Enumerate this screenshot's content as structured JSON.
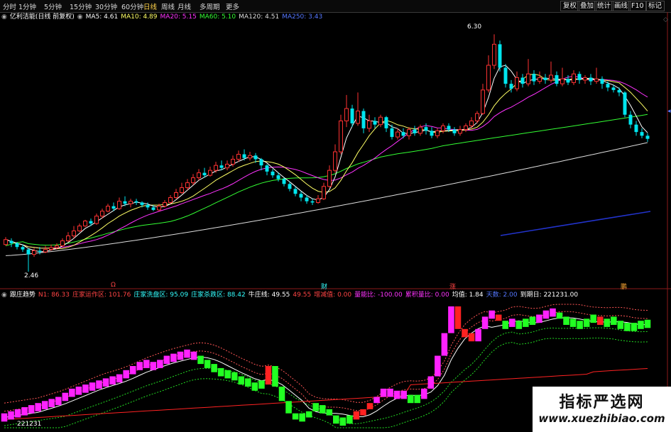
{
  "toolbar": {
    "left_tabs": [
      "分时",
      "1分钟",
      "5分钟",
      "15分钟",
      "30分钟",
      "60分钟",
      "日线",
      "周线",
      "月线",
      "多周期",
      "更多"
    ],
    "active_tab": "日线",
    "right_tabs": [
      "复权",
      "叠加",
      "统计",
      "画线",
      "F10",
      "标记"
    ]
  },
  "main_header": {
    "stock": "亿利洁能(日线 前复权)",
    "ma": [
      {
        "label": "MA5: 4.61",
        "color": "#ffffff"
      },
      {
        "label": "MA10: 4.89",
        "color": "#ffff66"
      },
      {
        "label": "MA20: 5.15",
        "color": "#ff33ff"
      },
      {
        "label": "MA60: 5.10",
        "color": "#33ff33"
      },
      {
        "label": "MA120: 4.51",
        "color": "#dddddd"
      },
      {
        "label": "MA250: 3.43",
        "color": "#5577ff"
      }
    ]
  },
  "sub_header": {
    "name": "跟庄趋势",
    "items": [
      {
        "label": "N1: 86.33",
        "color": "#ff4444"
      },
      {
        "label": "庄家运作区: 101.76",
        "color": "#ff4444"
      },
      {
        "label": "庄家洗盘区: 95.09",
        "color": "#33ffff"
      },
      {
        "label": "庄家杀跌区: 88.42",
        "color": "#33ffff"
      },
      {
        "label": "牛庄线: 49.55",
        "color": "#ffffff"
      },
      {
        "label": "49.55",
        "color": "#ff4444"
      },
      {
        "label": "增减值: 0.00",
        "color": "#ff4444"
      },
      {
        "label": "量能比: -100.00",
        "color": "#ff33ff"
      },
      {
        "label": "累积量比: 0.00",
        "color": "#ff33ff"
      },
      {
        "label": "均值: 1.84",
        "color": "#ffffff"
      },
      {
        "label": "天数: 2.00",
        "color": "#5577ff"
      },
      {
        "label": "到期日: 221231.00",
        "color": "#ffffff"
      }
    ]
  },
  "annotations": {
    "high_label": "6.30",
    "low_label": "2.46",
    "date_label": "221231",
    "event_markers": [
      "Ω",
      "财",
      "涨",
      "鹏"
    ]
  },
  "colors": {
    "up": "#ff3232",
    "down": "#00e5ee",
    "ma5": "#ffffff",
    "ma10": "#ffff66",
    "ma20": "#ff33ff",
    "ma60": "#33ff33",
    "ma120": "#dddddd",
    "ma250": "#2233cc",
    "zone_red": "#ff2222",
    "zone_magenta": "#ff22ff",
    "zone_green": "#22ff22"
  },
  "watermark": {
    "title": "指标严选网",
    "url": "www.xuezhibiao.com"
  },
  "chart_data": [
    {
      "type": "candlestick",
      "title": "亿利洁能(日线 前复权)",
      "y_range": [
        2.3,
        6.5
      ],
      "note": "values estimated from the chart, sequence of daily open/close/high/low",
      "candles": [
        [
          2.9,
          2.98,
          3.02,
          2.88
        ],
        [
          2.96,
          2.92,
          3.0,
          2.86
        ],
        [
          2.92,
          2.86,
          2.94,
          2.82
        ],
        [
          2.86,
          2.82,
          2.9,
          2.78
        ],
        [
          2.82,
          2.74,
          2.84,
          2.46
        ],
        [
          2.74,
          2.8,
          2.84,
          2.7
        ],
        [
          2.8,
          2.78,
          2.86,
          2.74
        ],
        [
          2.78,
          2.82,
          2.88,
          2.76
        ],
        [
          2.82,
          2.85,
          2.9,
          2.8
        ],
        [
          2.85,
          2.88,
          2.92,
          2.82
        ],
        [
          2.88,
          2.96,
          3.0,
          2.86
        ],
        [
          2.96,
          3.04,
          3.1,
          2.94
        ],
        [
          3.04,
          3.12,
          3.2,
          3.0
        ],
        [
          3.12,
          3.2,
          3.24,
          3.1
        ],
        [
          3.2,
          3.28,
          3.3,
          3.18
        ],
        [
          3.28,
          3.24,
          3.32,
          3.2
        ],
        [
          3.24,
          3.36,
          3.4,
          3.22
        ],
        [
          3.36,
          3.44,
          3.48,
          3.32
        ],
        [
          3.44,
          3.52,
          3.56,
          3.42
        ],
        [
          3.52,
          3.48,
          3.58,
          3.44
        ],
        [
          3.48,
          3.6,
          3.66,
          3.46
        ],
        [
          3.6,
          3.56,
          3.68,
          3.52
        ],
        [
          3.56,
          3.6,
          3.64,
          3.5
        ],
        [
          3.6,
          3.58,
          3.64,
          3.54
        ],
        [
          3.58,
          3.54,
          3.6,
          3.5
        ],
        [
          3.54,
          3.5,
          3.58,
          3.46
        ],
        [
          3.5,
          3.46,
          3.54,
          3.44
        ],
        [
          3.46,
          3.52,
          3.56,
          3.44
        ],
        [
          3.52,
          3.58,
          3.62,
          3.5
        ],
        [
          3.58,
          3.66,
          3.7,
          3.56
        ],
        [
          3.66,
          3.74,
          3.8,
          3.64
        ],
        [
          3.74,
          3.82,
          3.9,
          3.72
        ],
        [
          3.82,
          3.9,
          3.96,
          3.78
        ],
        [
          3.9,
          3.98,
          4.04,
          3.86
        ],
        [
          3.98,
          4.06,
          4.12,
          3.94
        ],
        [
          4.06,
          4.02,
          4.14,
          3.98
        ],
        [
          4.02,
          4.1,
          4.16,
          4.0
        ],
        [
          4.1,
          4.18,
          4.24,
          4.06
        ],
        [
          4.18,
          4.14,
          4.26,
          4.1
        ],
        [
          4.14,
          4.2,
          4.26,
          4.1
        ],
        [
          4.2,
          4.28,
          4.34,
          4.16
        ],
        [
          4.28,
          4.36,
          4.42,
          4.24
        ],
        [
          4.36,
          4.3,
          4.44,
          4.26
        ],
        [
          4.3,
          4.34,
          4.4,
          4.26
        ],
        [
          4.34,
          4.28,
          4.38,
          4.22
        ],
        [
          4.28,
          4.18,
          4.3,
          4.1
        ],
        [
          4.18,
          4.08,
          4.2,
          4.02
        ],
        [
          4.08,
          4.02,
          4.12,
          3.98
        ],
        [
          4.02,
          3.96,
          4.06,
          3.92
        ],
        [
          3.96,
          3.88,
          3.98,
          3.84
        ],
        [
          3.88,
          3.8,
          3.92,
          3.76
        ],
        [
          3.8,
          3.72,
          3.84,
          3.68
        ],
        [
          3.72,
          3.66,
          3.76,
          3.6
        ],
        [
          3.66,
          3.6,
          3.7,
          3.56
        ],
        [
          3.6,
          3.58,
          3.64,
          3.54
        ],
        [
          3.58,
          3.64,
          3.7,
          3.56
        ],
        [
          3.64,
          3.84,
          3.9,
          3.62
        ],
        [
          3.84,
          4.1,
          4.18,
          3.82
        ],
        [
          4.1,
          4.4,
          4.52,
          4.06
        ],
        [
          4.4,
          4.9,
          5.0,
          4.36
        ],
        [
          4.9,
          5.1,
          5.32,
          4.8
        ],
        [
          5.1,
          4.86,
          5.16,
          4.8
        ],
        [
          4.86,
          5.06,
          5.36,
          4.82
        ],
        [
          5.06,
          4.78,
          5.1,
          4.7
        ],
        [
          4.78,
          4.9,
          5.0,
          4.72
        ],
        [
          4.9,
          4.84,
          4.96,
          4.78
        ],
        [
          4.84,
          4.96,
          5.0,
          4.8
        ],
        [
          4.96,
          4.78,
          4.98,
          4.72
        ],
        [
          4.78,
          4.64,
          4.84,
          4.6
        ],
        [
          4.64,
          4.72,
          4.78,
          4.6
        ],
        [
          4.72,
          4.66,
          4.78,
          4.62
        ],
        [
          4.66,
          4.76,
          4.8,
          4.6
        ],
        [
          4.76,
          4.7,
          4.82,
          4.66
        ],
        [
          4.7,
          4.8,
          4.84,
          4.66
        ],
        [
          4.8,
          4.74,
          4.86,
          4.68
        ],
        [
          4.74,
          4.66,
          4.8,
          4.62
        ],
        [
          4.66,
          4.74,
          4.78,
          4.62
        ],
        [
          4.74,
          4.82,
          4.86,
          4.7
        ],
        [
          4.82,
          4.76,
          4.86,
          4.72
        ],
        [
          4.76,
          4.7,
          4.8,
          4.66
        ],
        [
          4.7,
          4.76,
          4.82,
          4.66
        ],
        [
          4.76,
          4.82,
          4.86,
          4.72
        ],
        [
          4.82,
          4.9,
          4.96,
          4.78
        ],
        [
          4.9,
          5.02,
          5.06,
          4.86
        ],
        [
          5.02,
          5.4,
          5.5,
          5.0
        ],
        [
          5.4,
          5.8,
          5.96,
          5.36
        ],
        [
          5.8,
          6.14,
          6.3,
          5.74
        ],
        [
          6.14,
          5.76,
          6.2,
          5.7
        ],
        [
          5.76,
          5.5,
          5.82,
          5.44
        ],
        [
          5.5,
          5.42,
          5.56,
          5.36
        ],
        [
          5.42,
          5.6,
          5.7,
          5.38
        ],
        [
          5.6,
          5.5,
          5.66,
          5.44
        ],
        [
          5.5,
          5.66,
          5.9,
          5.46
        ],
        [
          5.66,
          5.54,
          5.72,
          5.48
        ],
        [
          5.54,
          5.6,
          5.7,
          5.5
        ],
        [
          5.6,
          5.56,
          5.66,
          5.5
        ],
        [
          5.56,
          5.64,
          5.86,
          5.52
        ],
        [
          5.64,
          5.5,
          5.7,
          5.46
        ],
        [
          5.5,
          5.58,
          5.76,
          5.46
        ],
        [
          5.58,
          5.52,
          5.64,
          5.48
        ],
        [
          5.52,
          5.66,
          5.72,
          5.48
        ],
        [
          5.66,
          5.56,
          5.7,
          5.5
        ],
        [
          5.56,
          5.6,
          5.64,
          5.5
        ],
        [
          5.6,
          5.54,
          5.66,
          5.48
        ],
        [
          5.54,
          5.58,
          5.76,
          5.5
        ],
        [
          5.58,
          5.5,
          5.62,
          5.42
        ],
        [
          5.5,
          5.44,
          5.54,
          5.38
        ],
        [
          5.44,
          5.4,
          5.48,
          5.36
        ],
        [
          5.4,
          5.36,
          5.44,
          5.3
        ],
        [
          5.36,
          5.0,
          5.38,
          4.96
        ],
        [
          5.0,
          4.84,
          5.06,
          4.78
        ],
        [
          4.84,
          4.72,
          4.9,
          4.66
        ],
        [
          4.72,
          4.66,
          4.78,
          4.62
        ],
        [
          4.66,
          4.61,
          4.7,
          4.56
        ]
      ]
    },
    {
      "type": "heatmap-bar",
      "title": "跟庄趋势",
      "y_range": [
        0,
        120
      ],
      "bars": [
        {
          "c": "m",
          "v": 10
        },
        {
          "c": "m",
          "v": 12
        },
        {
          "c": "m",
          "v": 14
        },
        {
          "c": "m",
          "v": 16
        },
        {
          "c": "m",
          "v": 18
        },
        {
          "c": "m",
          "v": 20
        },
        {
          "c": "m",
          "v": 22
        },
        {
          "c": "m",
          "v": 24
        },
        {
          "c": "m",
          "v": 26
        },
        {
          "c": "m",
          "v": 30
        },
        {
          "c": "m",
          "v": 34
        },
        {
          "c": "m",
          "v": 36
        },
        {
          "c": "m",
          "v": 38
        },
        {
          "c": "m",
          "v": 40
        },
        {
          "c": "m",
          "v": 42
        },
        {
          "c": "m",
          "v": 44
        },
        {
          "c": "m",
          "v": 46
        },
        {
          "c": "m",
          "v": 48
        },
        {
          "c": "m",
          "v": 52
        },
        {
          "c": "m",
          "v": 56
        },
        {
          "c": "m",
          "v": 60
        },
        {
          "c": "m",
          "v": 62
        },
        {
          "c": "m",
          "v": 60
        },
        {
          "c": "m",
          "v": 62
        },
        {
          "c": "m",
          "v": 66
        },
        {
          "c": "m",
          "v": 68
        },
        {
          "c": "m",
          "v": 70
        },
        {
          "c": "m",
          "v": 72
        },
        {
          "c": "m",
          "v": 70
        },
        {
          "c": "g",
          "v": 66
        },
        {
          "c": "g",
          "v": 62
        },
        {
          "c": "g",
          "v": 58
        },
        {
          "c": "g",
          "v": 54
        },
        {
          "c": "g",
          "v": 52
        },
        {
          "c": "g",
          "v": 50
        },
        {
          "c": "g",
          "v": 46
        },
        {
          "c": "g",
          "v": 44
        },
        {
          "c": "g",
          "v": 40
        },
        {
          "c": "g",
          "v": 42
        },
        {
          "c": "r",
          "v": 60
        },
        {
          "c": "g",
          "v": 40
        },
        {
          "c": "g",
          "v": 26
        },
        {
          "c": "g",
          "v": 14
        },
        {
          "c": "g",
          "v": 8
        },
        {
          "c": "g",
          "v": 10
        },
        {
          "c": "g",
          "v": 16
        },
        {
          "c": "g",
          "v": 20
        },
        {
          "c": "g",
          "v": 18
        },
        {
          "c": "g",
          "v": 12
        },
        {
          "c": "g",
          "v": 8
        },
        {
          "c": "g",
          "v": 6
        },
        {
          "c": "g",
          "v": 8
        },
        {
          "c": "r",
          "v": 12
        },
        {
          "c": "r",
          "v": 18
        },
        {
          "c": "r",
          "v": 24
        },
        {
          "c": "m",
          "v": 30
        },
        {
          "c": "m",
          "v": 34
        },
        {
          "c": "m",
          "v": 34
        },
        {
          "c": "m",
          "v": 32
        },
        {
          "c": "m",
          "v": 32
        },
        {
          "c": "g",
          "v": 28
        },
        {
          "c": "g",
          "v": 28
        },
        {
          "c": "m",
          "v": 38
        },
        {
          "c": "m",
          "v": 50
        },
        {
          "c": "m",
          "v": 70
        },
        {
          "c": "m",
          "v": 92
        },
        {
          "c": "m",
          "v": 118
        },
        {
          "c": "r",
          "v": 96
        },
        {
          "c": "r",
          "v": 92
        },
        {
          "c": "r",
          "v": 84
        },
        {
          "c": "m",
          "v": 96
        },
        {
          "c": "m",
          "v": 108
        },
        {
          "c": "m",
          "v": 110
        },
        {
          "c": "r",
          "v": 104
        },
        {
          "c": "g",
          "v": 100
        },
        {
          "c": "m",
          "v": 102
        },
        {
          "c": "g",
          "v": 100
        },
        {
          "c": "g",
          "v": 102
        },
        {
          "c": "g",
          "v": 104
        },
        {
          "c": "m",
          "v": 106
        },
        {
          "c": "m",
          "v": 110
        },
        {
          "c": "m",
          "v": 112
        },
        {
          "c": "g",
          "v": 106
        },
        {
          "c": "g",
          "v": 104
        },
        {
          "c": "g",
          "v": 102
        },
        {
          "c": "g",
          "v": 100
        },
        {
          "c": "g",
          "v": 102
        },
        {
          "c": "g",
          "v": 106
        },
        {
          "c": "r",
          "v": 104
        },
        {
          "c": "g",
          "v": 102
        },
        {
          "c": "g",
          "v": 104
        },
        {
          "c": "g",
          "v": 100
        },
        {
          "c": "g",
          "v": 98
        },
        {
          "c": "g",
          "v": 98
        },
        {
          "c": "g",
          "v": 100
        },
        {
          "c": "g",
          "v": 101
        }
      ]
    }
  ]
}
